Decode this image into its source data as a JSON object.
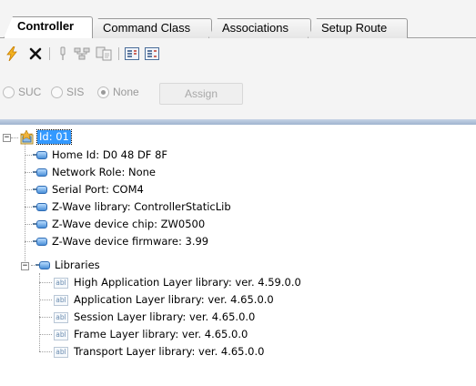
{
  "tabs": [
    {
      "label": "Controller",
      "active": true
    },
    {
      "label": "Command Class",
      "active": false
    },
    {
      "label": "Associations",
      "active": false
    },
    {
      "label": "Setup Route",
      "active": false
    }
  ],
  "toolbar": {
    "icons": [
      "lightning-icon",
      "delete-x-icon",
      "pin-icon",
      "network-icon",
      "document-transfer-icon",
      "list-view-icon-1",
      "list-view-icon-2"
    ]
  },
  "radio": {
    "suc": "SUC",
    "sis": "SIS",
    "none": "None",
    "selected": "None",
    "assign": "Assign"
  },
  "tree": {
    "root": "Id: 01",
    "items": [
      "Home Id: D0 48 DF 8F",
      "Network Role: None",
      "Serial Port: COM4",
      "Z-Wave library: ControllerStaticLib",
      "Z-Wave device chip: ZW0500",
      "Z-Wave device firmware:  3.99"
    ],
    "libraries": {
      "label": "Libraries",
      "children": [
        "High Application Layer library: ver. 4.59.0.0",
        "Application Layer library: ver. 4.65.0.0",
        "Session Layer library: ver. 4.65.0.0",
        "Frame Layer library: ver. 4.65.0.0",
        "Transport Layer library: ver. 4.65.0.0"
      ],
      "icon_text": "abl"
    },
    "expander_collapse": "−"
  },
  "colors": {
    "selection": "#3399ff",
    "splitter": "#a9bbd4",
    "panel": "#f4f4f4"
  }
}
